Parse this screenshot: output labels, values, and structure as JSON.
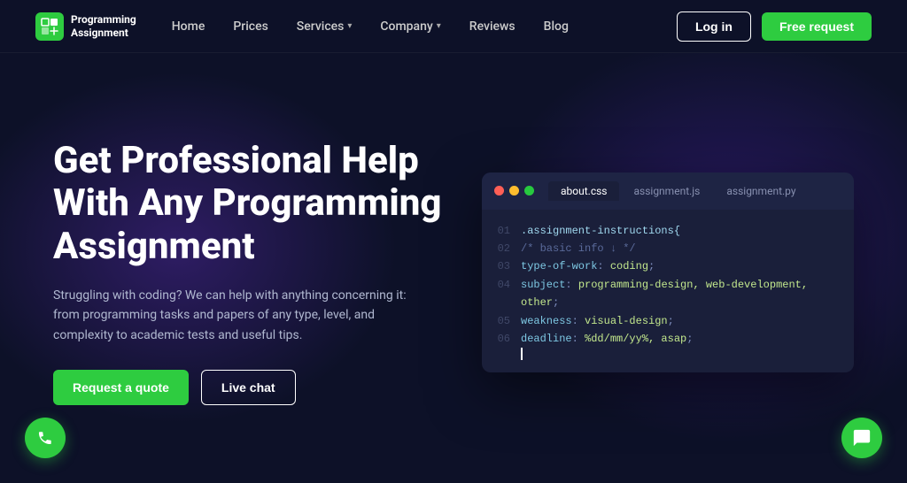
{
  "brand": {
    "logo_alt": "Programming Assignment Logo",
    "name_line1": "Programming",
    "name_line2": "Assignment"
  },
  "nav": {
    "links": [
      {
        "label": "Home",
        "has_dropdown": false
      },
      {
        "label": "Prices",
        "has_dropdown": false
      },
      {
        "label": "Services",
        "has_dropdown": true
      },
      {
        "label": "Company",
        "has_dropdown": true
      },
      {
        "label": "Reviews",
        "has_dropdown": false
      },
      {
        "label": "Blog",
        "has_dropdown": false
      }
    ],
    "login_label": "Log in",
    "free_request_label": "Free request"
  },
  "hero": {
    "title": "Get Professional Help With Any Programming Assignment",
    "subtitle": "Struggling with coding? We can help with anything concerning it: from programming tasks and papers of any type, level, and complexity to academic tests and useful tips.",
    "btn_quote": "Request a quote",
    "btn_chat": "Live chat"
  },
  "editor": {
    "tabs": [
      {
        "label": "about.css",
        "active": true
      },
      {
        "label": "assignment.js",
        "active": false
      },
      {
        "label": "assignment.py",
        "active": false
      }
    ],
    "lines": [
      {
        "num": "01",
        "content": ".assignment-instructions{",
        "parts": [
          {
            "text": ".assignment-instructions{",
            "class": "c-selector"
          }
        ]
      },
      {
        "num": "02",
        "content": "  /* basic info ↓ */",
        "parts": [
          {
            "text": "  /* basic info ↓ */",
            "class": "c-comment"
          }
        ]
      },
      {
        "num": "03",
        "content": "  type-of-work: coding;",
        "parts": [
          {
            "text": "  type-of-work",
            "class": "c-prop"
          },
          {
            "text": ": ",
            "class": "c-punct"
          },
          {
            "text": "coding",
            "class": "c-value"
          },
          {
            "text": ";",
            "class": "c-punct"
          }
        ]
      },
      {
        "num": "04",
        "content": "  subject: programming-design, web-development, other;",
        "parts": [
          {
            "text": "  subject",
            "class": "c-prop"
          },
          {
            "text": ": ",
            "class": "c-punct"
          },
          {
            "text": "programming-design, web-development, other",
            "class": "c-value"
          },
          {
            "text": ";",
            "class": "c-punct"
          }
        ]
      },
      {
        "num": "05",
        "content": "  weakness: visual-design;",
        "parts": [
          {
            "text": "  weakness",
            "class": "c-prop"
          },
          {
            "text": ": ",
            "class": "c-punct"
          },
          {
            "text": "visual-design",
            "class": "c-value"
          },
          {
            "text": ";",
            "class": "c-punct"
          }
        ]
      },
      {
        "num": "06",
        "content": "  deadline: %dd/mm/yy%, asap;",
        "parts": [
          {
            "text": "  deadline",
            "class": "c-prop"
          },
          {
            "text": ": ",
            "class": "c-punct"
          },
          {
            "text": "%dd/mm/yy%, asap",
            "class": "c-value"
          },
          {
            "text": ";",
            "class": "c-punct"
          }
        ]
      }
    ]
  },
  "floats": {
    "phone_aria": "Call us",
    "chat_aria": "Open chat"
  }
}
